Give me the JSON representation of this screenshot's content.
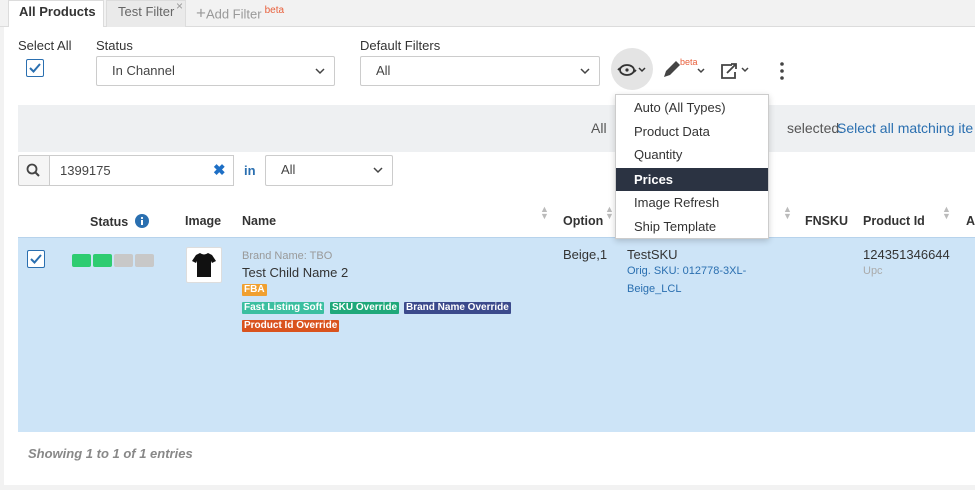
{
  "tabs": {
    "all_products": "All Products",
    "test_filter": "Test Filter",
    "add_filter": "Add Filter",
    "beta": "beta"
  },
  "filters": {
    "select_all_label": "Select All",
    "status_label": "Status",
    "status_value": "In Channel",
    "default_filters_label": "Default Filters",
    "default_filters_value": "All",
    "edit_beta": "beta"
  },
  "notice": {
    "text_prefix": "All",
    "text_suffix": "selected.",
    "link": "Select all matching ite"
  },
  "search": {
    "value": "1399175",
    "in_label": "in",
    "field_value": "All"
  },
  "columns": {
    "status": "Status",
    "image": "Image",
    "name": "Name",
    "option": "Option",
    "fnsku": "FNSKU",
    "product_id": "Product Id",
    "a": "A"
  },
  "row": {
    "checked": true,
    "status_bars": [
      "#2ecc71",
      "#2ecc71",
      "#c8c8c8",
      "#c8c8c8"
    ],
    "brand": "Brand Name: TBO",
    "name": "Test Child Name 2",
    "badges": {
      "fba": "FBA",
      "fast_listing": "Fast Listing Soft",
      "sku_override": "SKU Override",
      "brand_override": "Brand Name Override",
      "product_id_override": "Product Id Override"
    },
    "option": "Beige,1",
    "sku": "TestSKU",
    "orig_sku_line1": "Orig. SKU: 012778-3XL-",
    "orig_sku_line2": "Beige_LCL",
    "product_id": "124351346644",
    "product_id_type": "Upc"
  },
  "footer": {
    "entries": "Showing 1 to 1 of 1 entries"
  },
  "sync_menu": {
    "items": [
      "Auto (All Types)",
      "Product Data",
      "Quantity",
      "Prices",
      "Image Refresh",
      "Ship Template"
    ],
    "active": "Prices"
  },
  "colors": {
    "accent": "#2a6fb0",
    "menu_active": "#2b3342",
    "row_selected": "#cde4f7",
    "fba_badge": "#f0a030",
    "fast_listing_badge": "#3bbfa0",
    "sku_override_badge": "#1fa87a",
    "brand_override_badge": "#3b4a8c",
    "product_id_override_badge": "#d9531e"
  }
}
